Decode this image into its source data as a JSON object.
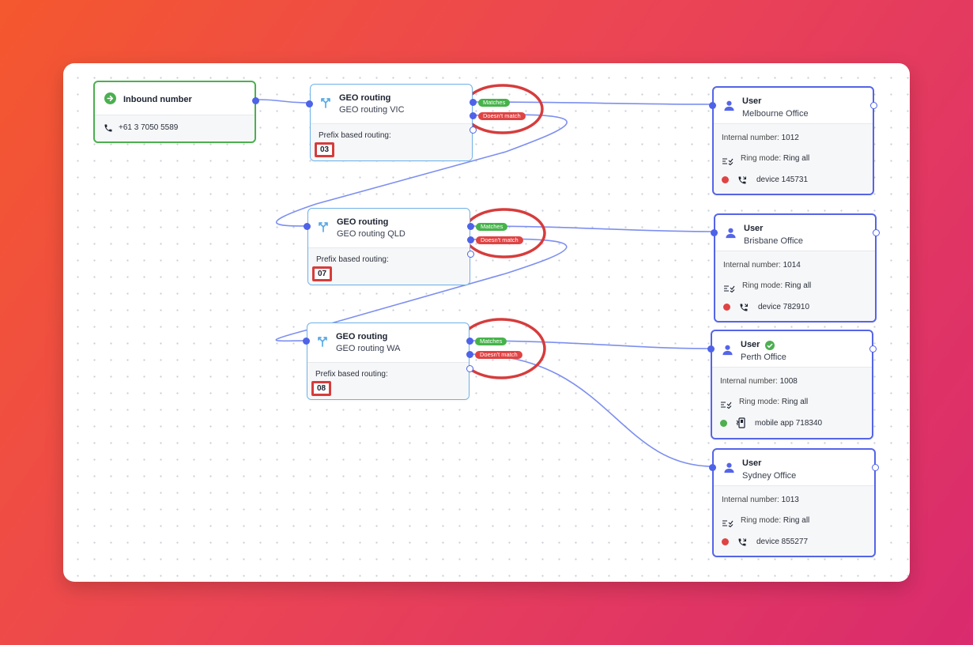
{
  "inbound": {
    "title": "Inbound number",
    "number": "+61 3 7050 5589"
  },
  "geo": [
    {
      "title": "GEO routing",
      "name": "GEO routing VIC",
      "prefix_label": "Prefix based routing:",
      "prefix": "03",
      "match": "Matches",
      "nomatch": "Doesn't match"
    },
    {
      "title": "GEO routing",
      "name": "GEO routing QLD",
      "prefix_label": "Prefix based routing:",
      "prefix": "07",
      "match": "Matches",
      "nomatch": "Doesn't match"
    },
    {
      "title": "GEO routing",
      "name": "GEO routing WA",
      "prefix_label": "Prefix based routing:",
      "prefix": "08",
      "match": "Matches",
      "nomatch": "Doesn't match"
    }
  ],
  "users": [
    {
      "title": "User",
      "name": "Melbourne Office",
      "internal_label": "Internal number:",
      "internal": "1012",
      "ring_label": "Ring mode:",
      "ring": "Ring all",
      "device": "device 145731",
      "status_color": "#e04343",
      "verified": false
    },
    {
      "title": "User",
      "name": "Brisbane Office",
      "internal_label": "Internal number:",
      "internal": "1014",
      "ring_label": "Ring mode:",
      "ring": "Ring all",
      "device": "device 782910",
      "status_color": "#e04343",
      "verified": false
    },
    {
      "title": "User",
      "name": "Perth Office",
      "internal_label": "Internal number:",
      "internal": "1008",
      "ring_label": "Ring mode:",
      "ring": "Ring all",
      "device": "mobile app 718340",
      "status_color": "#4caf50",
      "verified": true
    },
    {
      "title": "User",
      "name": "Sydney Office",
      "internal_label": "Internal number:",
      "internal": "1013",
      "ring_label": "Ring mode:",
      "ring": "Ring all",
      "device": "device 855277",
      "status_color": "#e04343",
      "verified": false
    }
  ],
  "colors": {
    "wire": "#7d8ff0",
    "port": "#4e63e8",
    "highlight": "#d63c3c",
    "match": "#46b34a",
    "nomatch": "#e04343"
  }
}
